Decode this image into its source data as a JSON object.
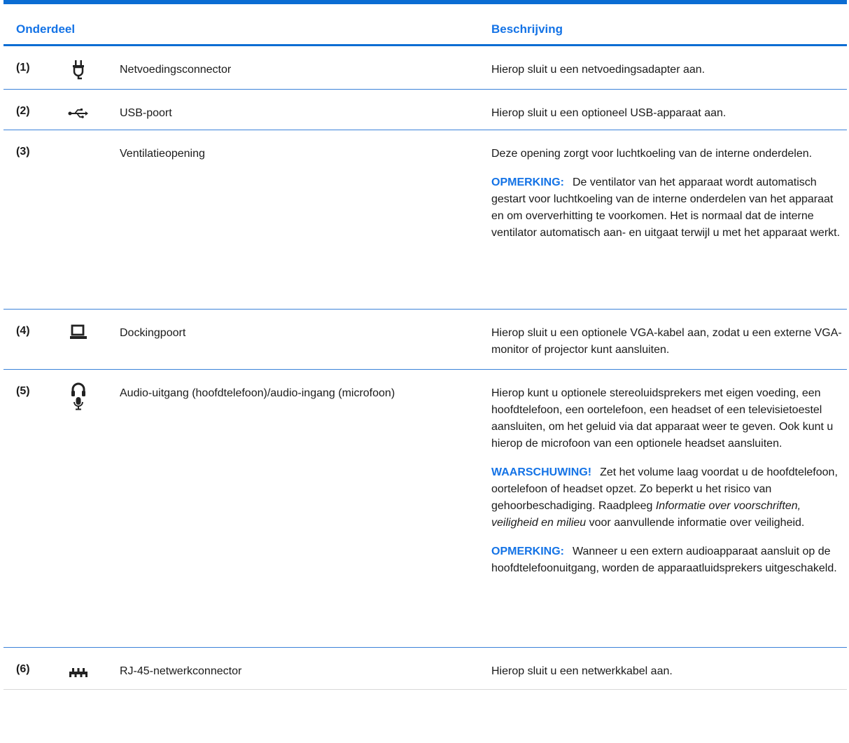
{
  "header": {
    "col1": "Onderdeel",
    "col2": "Beschrijving"
  },
  "rows": [
    {
      "num": "(1)",
      "icon": "power-plug-icon",
      "name": "Netvoedingsconnector",
      "desc": "Hierop sluit u een netvoedingsadapter aan."
    },
    {
      "num": "(2)",
      "icon": "usb-icon",
      "name": "USB-poort",
      "desc": "Hierop sluit u een optioneel USB-apparaat aan."
    },
    {
      "num": "(3)",
      "icon": "",
      "name": "Ventilatieopening",
      "desc": "Deze opening zorgt voor luchtkoeling van de interne onderdelen.",
      "note_label": "OPMERKING:",
      "note_text": "De ventilator van het apparaat wordt automatisch gestart voor luchtkoeling van de interne onderdelen van het apparaat en om oververhitting te voorkomen. Het is normaal dat de interne ventilator automatisch aan- en uitgaat terwijl u met het apparaat werkt."
    },
    {
      "num": "(4)",
      "icon": "docking-port-icon",
      "name": "Dockingpoort",
      "desc": "Hierop sluit u een optionele VGA-kabel aan, zodat u een externe VGA-monitor of projector kunt aansluiten."
    },
    {
      "num": "(5)",
      "icon": "headphone-microphone-icon",
      "name": "Audio-uitgang (hoofdtelefoon)/audio-ingang (microfoon)",
      "desc": "Hierop kunt u optionele stereoluidsprekers met eigen voeding, een hoofdtelefoon, een oortelefoon, een headset of een televisietoestel aansluiten, om het geluid via dat apparaat weer te geven. Ook kunt u hierop de microfoon van een optionele headset aansluiten.",
      "warn_label": "WAARSCHUWING!",
      "warn_text_1": "Zet het volume laag voordat u de hoofdtelefoon, oortelefoon of headset opzet. Zo beperkt u het risico van gehoorbeschadiging. Raadpleeg ",
      "warn_italic": "Informatie over voorschriften, veiligheid en milieu",
      "warn_text_2": " voor aanvullende informatie over veiligheid.",
      "note_label": "OPMERKING:",
      "note_text": "Wanneer u een extern audioapparaat aansluit op de hoofdtelefoonuitgang, worden de apparaatluidsprekers uitgeschakeld."
    },
    {
      "num": "(6)",
      "icon": "network-icon",
      "name": "RJ-45-netwerkconnector",
      "desc": "Hierop sluit u een netwerkkabel aan."
    }
  ]
}
